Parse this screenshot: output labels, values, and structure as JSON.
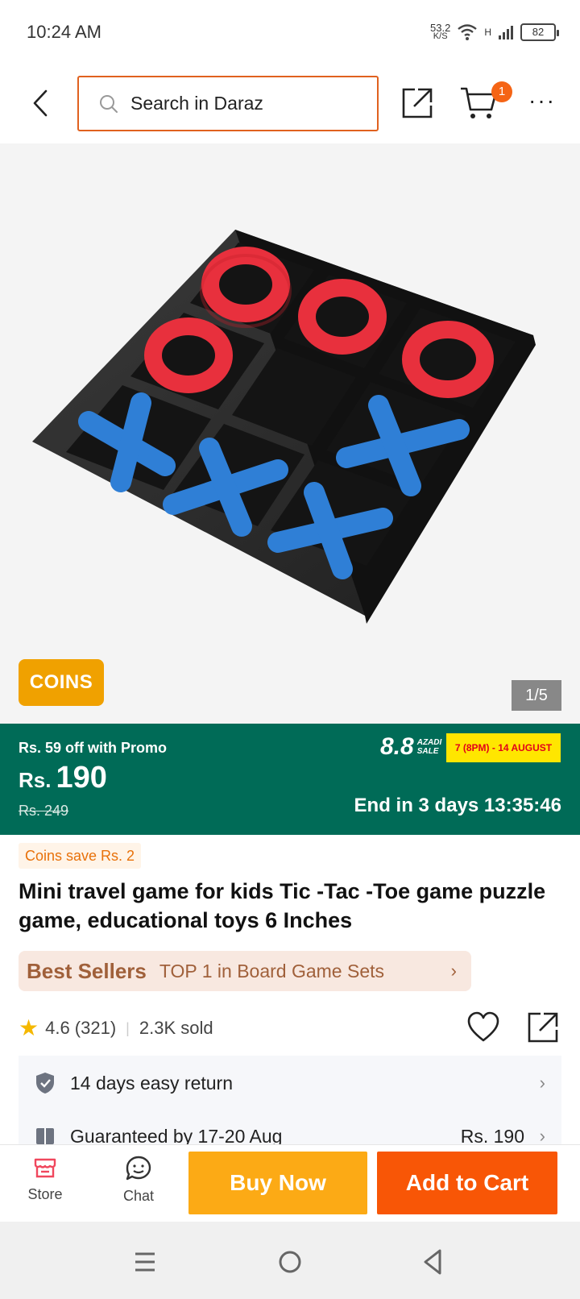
{
  "status_bar": {
    "time": "10:24 AM",
    "net_speed": "53.2",
    "net_unit": "K/S",
    "signal_type": "H",
    "battery": "82"
  },
  "header": {
    "search_placeholder": "Search in Daraz",
    "cart_count": "1",
    "more_label": "···"
  },
  "gallery": {
    "coins_badge": "COINS",
    "page_indicator": "1/5"
  },
  "promo": {
    "promo_off": "Rs. 59 off with Promo",
    "currency": "Rs.",
    "price": "190",
    "original_price": "Rs. 249",
    "sale_number": "8.8",
    "sale_word": "AZADI SALE",
    "sale_dates": "7 (8PM) - 14 AUGUST",
    "countdown": "End in 3 days 13:35:46",
    "colors": {
      "band": "#006b57",
      "accent": "#f85606"
    }
  },
  "product": {
    "coins_save": "Coins save Rs. 2",
    "title": "Mini travel game for kids Tic -Tac -Toe game puzzle game, educational toys 6 Inches",
    "best_sellers_label": "Best Sellers",
    "best_sellers_text": "TOP 1 in Board Game Sets",
    "rating": "4.6 (321)",
    "sold": "2.3K sold"
  },
  "services": [
    {
      "text": "14 days easy return",
      "price": ""
    },
    {
      "text": "Guaranteed by 17-20 Aug",
      "price": "Rs. 190"
    }
  ],
  "bottom_bar": {
    "store_label": "Store",
    "chat_label": "Chat",
    "buy_now_label": "Buy Now",
    "add_to_cart_label": "Add to Cart"
  }
}
